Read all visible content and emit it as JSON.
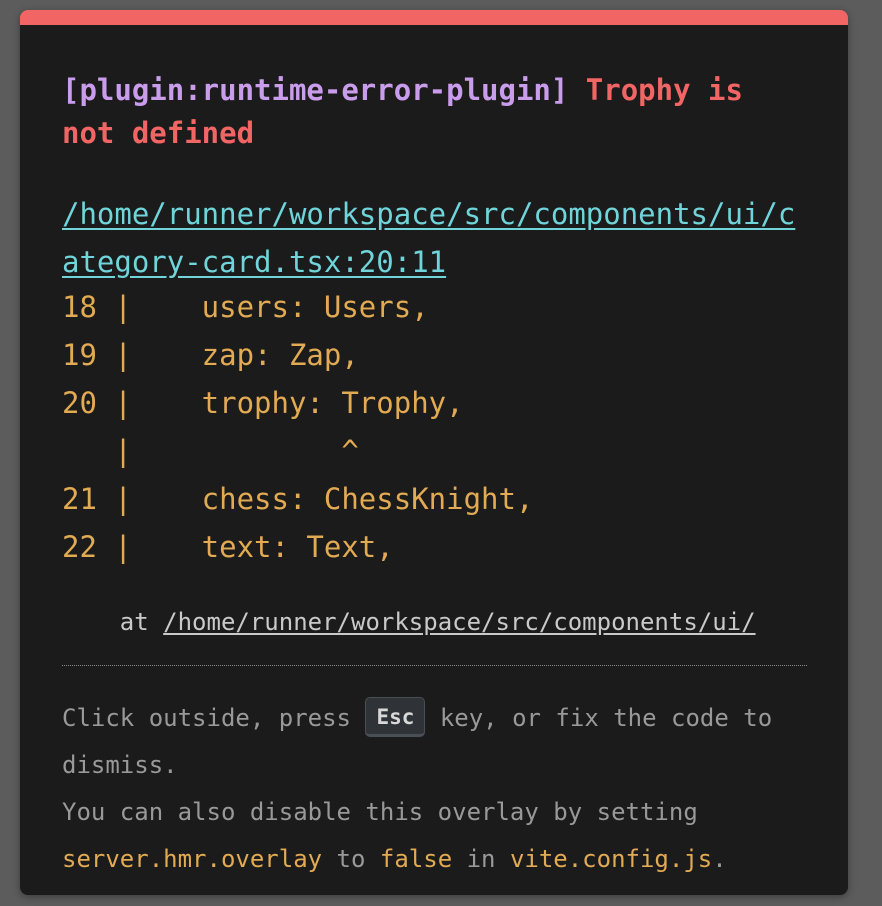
{
  "error": {
    "plugin": "[plugin:runtime-error-plugin]",
    "message": "Trophy is not defined",
    "file": "/home/runner/workspace/src/components/ui/category-card.tsx:20:11"
  },
  "frame": {
    "lines": [
      "18 |    users: Users,",
      "19 |    zap: Zap,",
      "20 |    trophy: Trophy,",
      "   |            ^",
      "21 |    chess: ChessKnight,",
      "22 |    text: Text,"
    ]
  },
  "stack": {
    "prefix": "    at ",
    "path": "/home/runner/workspace/src/components/ui/"
  },
  "tip": {
    "part1": "Click outside, press ",
    "key": "Esc",
    "part2": " key, or fix the code to dismiss.",
    "part3": "You can also disable this overlay by setting ",
    "setting": "server.hmr.overlay",
    "part4": " to ",
    "value": "false",
    "part5": " in ",
    "config_file": "vite.config.js",
    "part6": "."
  },
  "colors": {
    "accent_red": "#f16565",
    "plugin_purple": "#c99dec",
    "link_cyan": "#6fd5da",
    "code_yellow": "#e2aa53",
    "background": "#1b1b1b"
  }
}
